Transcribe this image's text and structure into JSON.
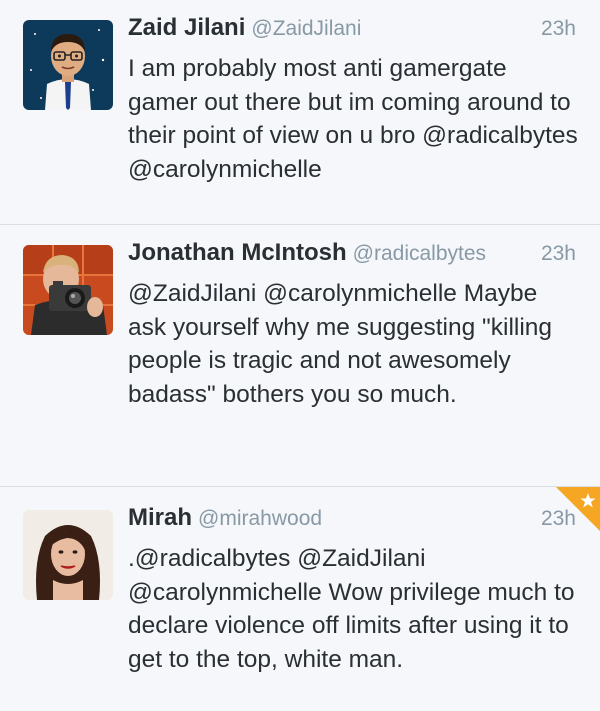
{
  "tweets": [
    {
      "name": "Zaid Jilani",
      "handle": "@ZaidJilani",
      "time": "23h",
      "text": "I am probably most anti gamergate gamer out there but im coming around to their point of view on u bro @radicalbytes @carolynmichelle",
      "avatar_icon": "cartoon-man-avatar"
    },
    {
      "name": "Jonathan McIntosh",
      "handle": "@radicalbytes",
      "time": "23h",
      "text": "@ZaidJilani @carolynmichelle Maybe ask yourself why me suggesting \"killing people is tragic and not awesomely badass\" bothers you so much.",
      "avatar_icon": "camera-selfie-avatar"
    },
    {
      "name": "Mirah",
      "handle": "@mirahwood",
      "time": "23h",
      "text": ".@radicalbytes @ZaidJilani @carolynmichelle Wow privilege much to declare violence off limits after using it to get to the top, white man.",
      "avatar_icon": "woman-portrait-avatar",
      "favorited": true
    }
  ],
  "colors": {
    "background": "#f5f7fa",
    "name": "#292f33",
    "meta": "#8899a6",
    "divider": "#dcdfe2",
    "favorite": "#f5a623"
  }
}
